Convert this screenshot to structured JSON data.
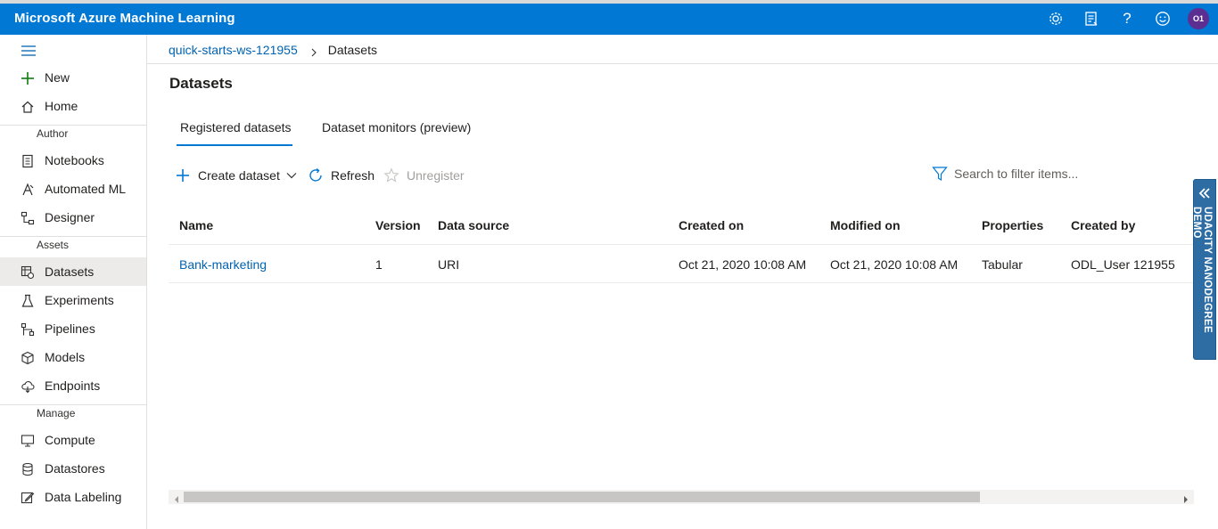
{
  "app": {
    "title": "Microsoft Azure Machine Learning"
  },
  "topbar": {
    "icons": [
      "settings-gear-icon",
      "feedback-list-icon",
      "help-question-icon",
      "smiley-feedback-icon"
    ],
    "avatar_initials": "O1"
  },
  "sidebar": {
    "items_top": [
      {
        "label": "New",
        "icon": "plus-icon"
      },
      {
        "label": "Home",
        "icon": "home-icon"
      }
    ],
    "sections": [
      {
        "title": "Author",
        "items": [
          {
            "label": "Notebooks",
            "icon": "notebook-icon"
          },
          {
            "label": "Automated ML",
            "icon": "automated-ml-icon"
          },
          {
            "label": "Designer",
            "icon": "designer-icon"
          }
        ]
      },
      {
        "title": "Assets",
        "items": [
          {
            "label": "Datasets",
            "icon": "datasets-icon",
            "active": true
          },
          {
            "label": "Experiments",
            "icon": "flask-icon"
          },
          {
            "label": "Pipelines",
            "icon": "pipeline-icon"
          },
          {
            "label": "Models",
            "icon": "cube-icon"
          },
          {
            "label": "Endpoints",
            "icon": "cloud-endpoint-icon"
          }
        ]
      },
      {
        "title": "Manage",
        "items": [
          {
            "label": "Compute",
            "icon": "monitor-icon"
          },
          {
            "label": "Datastores",
            "icon": "database-icon"
          },
          {
            "label": "Data Labeling",
            "icon": "edit-label-icon"
          }
        ]
      }
    ]
  },
  "breadcrumb": {
    "workspace": "quick-starts-ws-121955",
    "current": "Datasets"
  },
  "page": {
    "title": "Datasets"
  },
  "tabs": [
    {
      "label": "Registered datasets",
      "selected": true
    },
    {
      "label": "Dataset monitors (preview)",
      "selected": false
    }
  ],
  "toolbar": {
    "create_label": "Create dataset",
    "refresh_label": "Refresh",
    "unregister_label": "Unregister",
    "search_placeholder": "Search to filter items..."
  },
  "table": {
    "columns": [
      "Name",
      "Version",
      "Data source",
      "Created on",
      "Modified on",
      "Properties",
      "Created by"
    ],
    "rows": [
      [
        "Bank-marketing",
        "1",
        "URI",
        "Oct 21, 2020 10:08 AM",
        "Oct 21, 2020 10:08 AM",
        "Tabular",
        "ODL_User 121955"
      ]
    ]
  },
  "side_panel": {
    "label": "UDACITY NANODEGREE DEMO"
  },
  "colors": {
    "brand": "#0078d4",
    "link": "#0063b1",
    "side_tab": "#2e6da4",
    "avatar": "#5c2e91"
  }
}
